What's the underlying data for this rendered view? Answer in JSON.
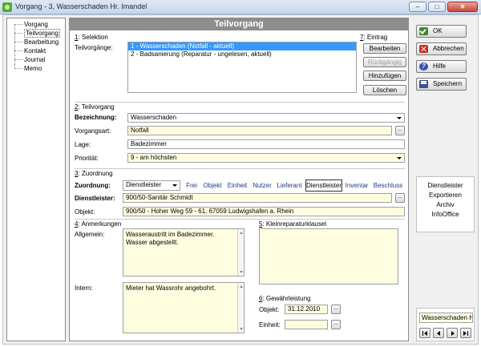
{
  "window": {
    "title": "Vorgang - 3, Wasserschaden Hr. Imandel",
    "minimize": "–",
    "maximize": "□",
    "close": "✕"
  },
  "nav": {
    "items": [
      {
        "label": "Vorgang"
      },
      {
        "label": "Teilvorgang"
      },
      {
        "label": "Bearbeitung"
      },
      {
        "label": "Kontakt"
      },
      {
        "label": "Journal"
      },
      {
        "label": "Memo"
      }
    ]
  },
  "header": {
    "title": "Teilvorgang"
  },
  "selektion": {
    "num": "1",
    "title": ": Selektion",
    "label": "Teilvorgänge:",
    "items": [
      "1 - Wasserschaden (Notfall - aktuell)",
      "2 - Badsanierung (Reparatur - ungelesen, aktuell)"
    ]
  },
  "eintrag": {
    "num": "7",
    "title": ": Eintrag",
    "buttons": [
      "Bearbeiten",
      "Rückgängig",
      "Hinzufügen",
      "Löschen"
    ]
  },
  "teilvorgang": {
    "num": "2",
    "title": ": Teilvorgang",
    "bezeichnung_label": "Bezeichnung:",
    "bezeichnung_value": "Wasserschaden",
    "vorgangsart_label": "Vorgangsart:",
    "vorgangsart_value": "Notfall",
    "lage_label": "Lage:",
    "lage_value": "Badezimmer",
    "prioritaet_label": "Priorität:",
    "prioritaet_value": "9 - am höchsten"
  },
  "zuordnung": {
    "num": "3",
    "title": ": Zuordnung",
    "label": "Zuordnung:",
    "select_value": "Dienstleister",
    "types": [
      "Frei",
      "Objekt",
      "Einheit",
      "Nutzer",
      "Lieferant",
      "Dienstleister",
      "Inventar",
      "Beschluss"
    ],
    "selected_type": "Dienstleister",
    "dienstleister_label": "Dienstleister:",
    "dienstleister_value": "900/50-Sanitär Schmidt",
    "objekt_label": "Objekt:",
    "objekt_value": "900/50 - Hoher Weg 59 - 61, 67059 Ludwigshafen a. Rhein"
  },
  "anmerkungen": {
    "num": "4",
    "title": ": Anmerkungen",
    "allgemein_label": "Allgemein:",
    "allgemein_value": "Wasseraustritt im Badezimmer. Wasser abgestellt.",
    "intern_label": "Intern:",
    "intern_value": "Mieter hat Wassrohr angebohrt."
  },
  "kleinreparatur": {
    "num": "5",
    "title": ": Kleinreparaturklausel"
  },
  "gewaehrleistung": {
    "num": "6",
    "title": ": Gewährleistung",
    "objekt_label": "Objekt:",
    "objekt_value": "31.12.2010",
    "einheit_label": "Einheit:",
    "einheit_value": ""
  },
  "actions": {
    "ok": "OK",
    "abbrechen": "Abbrechen",
    "hilfe": "Hilfe",
    "speichern": "Speichern"
  },
  "links": [
    "Dienstleister",
    "Exportieren",
    "Archiv",
    "InfoOffice"
  ],
  "record": {
    "current": "Wasserschaden H"
  },
  "ellipsis": "..."
}
